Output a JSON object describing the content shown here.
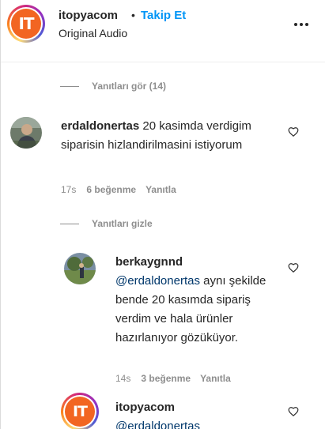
{
  "header": {
    "username": "itopyacom",
    "separator": "•",
    "follow_label": "Takip Et",
    "subtitle": "Original Audio",
    "logo_text": "IT"
  },
  "toggles": {
    "view_replies": "Yanıtları gör (14)",
    "hide_replies": "Yanıtları gizle"
  },
  "comments": [
    {
      "username": "erdaldonertas",
      "text": "20 kasimda verdigim siparisin hizlandirilmasini istiyorum",
      "time": "17s",
      "likes": "6 beğenme",
      "reply": "Yanıtla"
    },
    {
      "username": "berkaygnnd",
      "mention": "@erdaldonertas",
      "text": "aynı şekilde bende 20 kasımda sipariş verdim ve hala ürünler hazırlanıyor gözüküyor.",
      "time": "14s",
      "likes": "3 beğenme",
      "reply": "Yanıtla"
    },
    {
      "username": "itopyacom",
      "mention": "@erdaldonertas",
      "logo_text": "IT"
    }
  ],
  "colors": {
    "follow": "#0095f6",
    "mention": "#00376b",
    "meta": "#8e8e8e",
    "logo": "#f26522"
  }
}
